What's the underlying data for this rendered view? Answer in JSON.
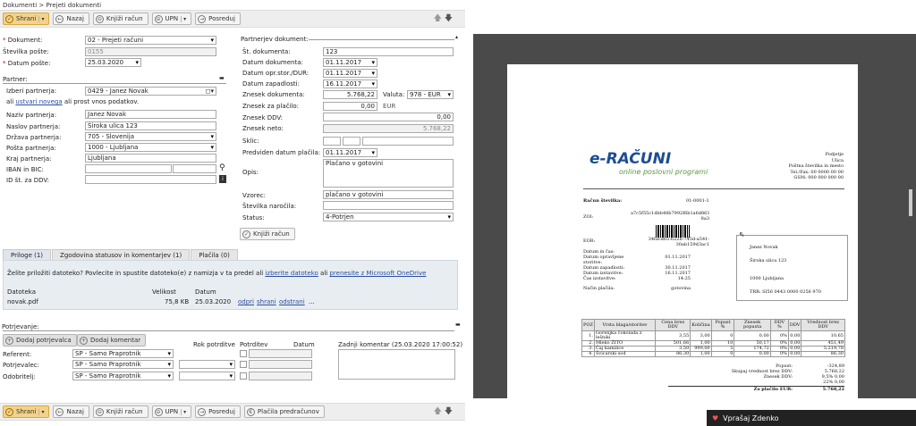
{
  "breadcrumb": "Dokumenti > Prejeti dokumenti",
  "toolbar": {
    "save": "Shrani",
    "back": "Nazaj",
    "post": "Knjiži račun",
    "upn": "UPN",
    "forward": "Posreduj",
    "invoice_payment": "Plačila predračunov"
  },
  "doc": {
    "document_label": "Dokument:",
    "document_value": "02 - Prejeti računi",
    "number_label": "Številka pošte:",
    "number_value": "0155",
    "date_label": "Datum pošte:",
    "date_value": "25.03.2020"
  },
  "partner": {
    "title": "Partner:",
    "choose_label": "Izberi partnerja:",
    "choose_value": "0429 - Janez Novak",
    "hint_pre": "ali ",
    "hint_link": "ustvari novega",
    "hint_post": " ali prost vnos podatkov.",
    "name_label": "Naziv partnerja:",
    "name_value": "Janez Novak",
    "address_label": "Naslov partnerja:",
    "address_value": "Široka ulica 123",
    "country_label": "Država partnerja:",
    "country_value": "705 - Slovenija",
    "post_label": "Pošta partnerja:",
    "post_value": "1000 - Ljubljana",
    "city_label": "Kraj partnerja:",
    "city_value": "Ljubljana",
    "iban_label": "IBAN in BIC:",
    "vat_label": "ID št. za DDV:"
  },
  "pdoc": {
    "title": "Partnerjev dokument:",
    "no_label": "Št. dokumenta:",
    "no_value": "123",
    "date_label": "Datum dokumenta:",
    "date_value": "01.11.2017",
    "vat_date_label": "Datum opr.stor./DUR:",
    "vat_date_value": "01.11.2017",
    "due_label": "Datum zapadlosti:",
    "due_value": "16.11.2017",
    "amount_label": "Znesek dokumenta:",
    "amount_value": "5.768,22",
    "currency_label": "Valuta:",
    "currency_value": "978 - EUR",
    "pay_label": "Znesek za plačilo:",
    "pay_value": "0,00",
    "pay_unit": "EUR",
    "vat_label": "Znesek DDV:",
    "vat_value": "0,00",
    "net_label": "Znesek neto:",
    "net_value": "5.768,22",
    "ref_label": "Sklic:",
    "paydate_label": "Predviden datum plačila:",
    "paydate_value": "01.11.2017",
    "desc_label": "Opis:",
    "desc_value": "Plačano v gotovini",
    "pattern_label": "Vzorec:",
    "pattern_value": "plačano v gotovini",
    "order_label": "Številka naročila:",
    "status_label": "Status:",
    "status_value": "4-Potrjen",
    "post_btn": "Knjiži račun"
  },
  "tabs": [
    "Priloge (1)",
    "Zgodovina statusov in komentarjev (1)",
    "Plačila (0)"
  ],
  "attach": {
    "prompt": "Želite priložiti datoteko? Povlecite in spustite datoteko(e) z namizja v ta predel ali ",
    "link1": "izberite datoteko",
    "mid": " ali ",
    "link2": "prenesite z Microsoft OneDrive",
    "col_file": "Datoteka",
    "col_size": "Velikost",
    "col_date": "Datum",
    "file": "novak.pdf",
    "size": "75,8 KB",
    "date": "25.03.2020",
    "open": "odpri",
    "share": "shrani",
    "remove": "odstrani",
    "more": "..."
  },
  "approve": {
    "title": "Potrjevanje:",
    "add_approver": "Dodaj potrjevalca",
    "add_comment": "Dodaj komentar",
    "col_deadline": "Rok potrditve",
    "col_approver": "Potrditev",
    "col_date": "Datum",
    "last_comment": "Zadnji komentar (25.03.2020 17:00:52)",
    "rows": [
      {
        "label": "Referent:",
        "value": "SP - Samo Praprotnik"
      },
      {
        "label": "Potrjevalec:",
        "value": "SP - Samo Praprotnik"
      },
      {
        "label": "Odobritelj:",
        "value": "SP - Samo Praprotnik"
      }
    ]
  },
  "chat": "Vprašaj Zdenko",
  "invoice": {
    "logo": "e-RAČUNI",
    "tagline": "online poslovni programi",
    "company": [
      "Podjetje",
      "Ulica",
      "Poštna številka in mesto",
      "Tel./Fax: 00 0000 00 00",
      "GSM: 000 000 000 00"
    ],
    "num_label": "Račun številka:",
    "num_value": "01-0001-1",
    "zoi_label": "ZOI:",
    "zoi_value": "a7c5f55c1dbb48b7992f6b1a6d861 8a3",
    "eor_label": "EOR:",
    "eor_value": "34facd65-622b-745d-a541-30ab159d3ac1",
    "meta": [
      [
        "Datum in čas:",
        ""
      ],
      [
        "Datum opravljene storitve:",
        "01.11.2017"
      ],
      [
        "Datum zapadlosti:",
        "30.11.2017"
      ],
      [
        "Datum izstavitve:",
        "16.11.2017"
      ],
      [
        "Čas izstavitve:",
        "14:25"
      ],
      [
        "Način plačila:",
        "gotovina"
      ]
    ],
    "buyer": [
      "Janez Novak",
      "Široka ulica 123",
      "1000 Ljubljana",
      "TRR: SI56 0443 0000 0256 970"
    ],
    "headers": [
      "POZ",
      "Vrsta blaga/storitev",
      "Cena brez DDV",
      "Količina",
      "Popust %",
      "Znesek popusta",
      "DDV %",
      "DDV",
      "Vrednost brez DDV"
    ],
    "rows": [
      [
        "1.",
        "Gorenjka čokolada z lešniki",
        "3,55",
        "3,00",
        "0",
        "0,00",
        "0%",
        "0,00",
        "10,65"
      ],
      [
        "2.",
        "Mleko ŽITO",
        "501,66",
        "1,00",
        "10",
        "50,17",
        "0%",
        "0,00",
        "451,49"
      ],
      [
        "3.",
        "Čaj kamilice",
        "3,50",
        "999,00",
        "5",
        "174,72",
        "0%",
        "0,00",
        "5.219,78"
      ],
      [
        "4.",
        "Švicarski sod",
        "86,30",
        "1,00",
        "0",
        "0,00",
        "0%",
        "0,00",
        "86,30"
      ]
    ],
    "sum": [
      [
        "Popust:",
        "-324,89"
      ],
      [
        "Skupaj vrednost brez DDV:",
        "5.768,22"
      ],
      [
        "Znesek DDV:",
        "9,5%   0,00"
      ],
      [
        "",
        "22%   0,00"
      ]
    ],
    "total_label": "Za plačilo EUR:",
    "total_value": "5.768,22"
  }
}
